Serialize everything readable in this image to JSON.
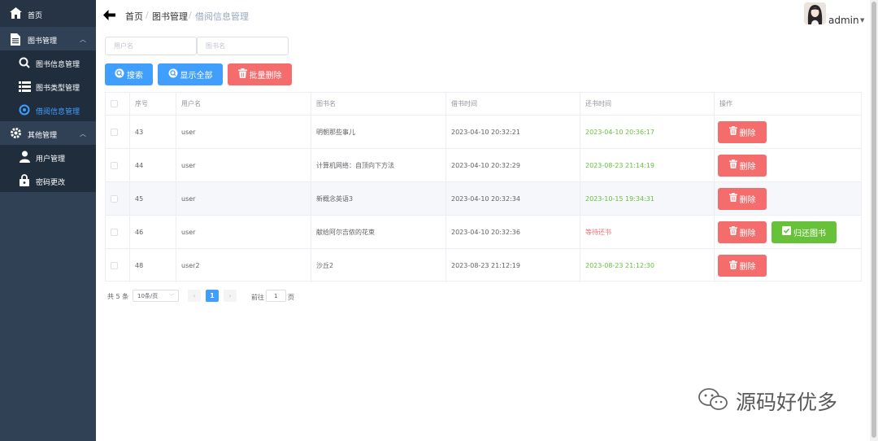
{
  "sidebar": {
    "items": [
      {
        "label": "首页",
        "icon": "home-icon"
      },
      {
        "label": "图书管理",
        "icon": "document-icon"
      },
      {
        "label": "图书信息管理",
        "icon": "search-icon"
      },
      {
        "label": "图书类型管理",
        "icon": "list-icon"
      },
      {
        "label": "借阅信息管理",
        "icon": "eye-icon"
      },
      {
        "label": "其他管理",
        "icon": "gear-icon"
      },
      {
        "label": "用户管理",
        "icon": "user-icon"
      },
      {
        "label": "密码更改",
        "icon": "lock-icon"
      }
    ]
  },
  "header": {
    "breadcrumb": [
      "首页",
      "图书管理",
      "借阅信息管理"
    ],
    "username": "admin"
  },
  "filters": {
    "user_placeholder": "用户名",
    "book_placeholder": "图书名"
  },
  "toolbar": {
    "search": "搜索",
    "show_all": "显示全部",
    "batch_delete": "批量删除"
  },
  "table": {
    "headers": [
      "序号",
      "用户名",
      "图书名",
      "借书时间",
      "还书时间",
      "操作"
    ],
    "rows": [
      {
        "id": "43",
        "user": "user",
        "book": "明朝那些事儿",
        "borrow": "2023-04-10 20:32:21",
        "return": "2023-04-10 20:36:17",
        "returned": true
      },
      {
        "id": "44",
        "user": "user",
        "book": "计算机网络：自顶向下方法",
        "borrow": "2023-04-10 20:32:29",
        "return": "2023-08-23 21:14:19",
        "returned": true
      },
      {
        "id": "45",
        "user": "user",
        "book": "新概念英语3",
        "borrow": "2023-04-10 20:32:34",
        "return": "2023-10-15 19:34:31",
        "returned": true
      },
      {
        "id": "46",
        "user": "user",
        "book": "献给阿尔吉侬的花束",
        "borrow": "2023-04-10 20:32:36",
        "return": "等待还书",
        "returned": false
      },
      {
        "id": "48",
        "user": "user2",
        "book": "沙丘2",
        "borrow": "2023-08-23 21:12:19",
        "return": "2023-08-23 21:12:30",
        "returned": true
      }
    ],
    "delete_label": "删除",
    "return_label": "归还图书"
  },
  "pagination": {
    "total": "共 5 条",
    "page_size": "10条/页",
    "current": "1",
    "goto_label": "前往",
    "goto_value": "1",
    "page_suffix": "页"
  },
  "watermark": "源码好优多",
  "colors": {
    "sidebar": "#304156",
    "primary": "#409eff",
    "danger": "#f56c6c",
    "success": "#67c23a"
  }
}
